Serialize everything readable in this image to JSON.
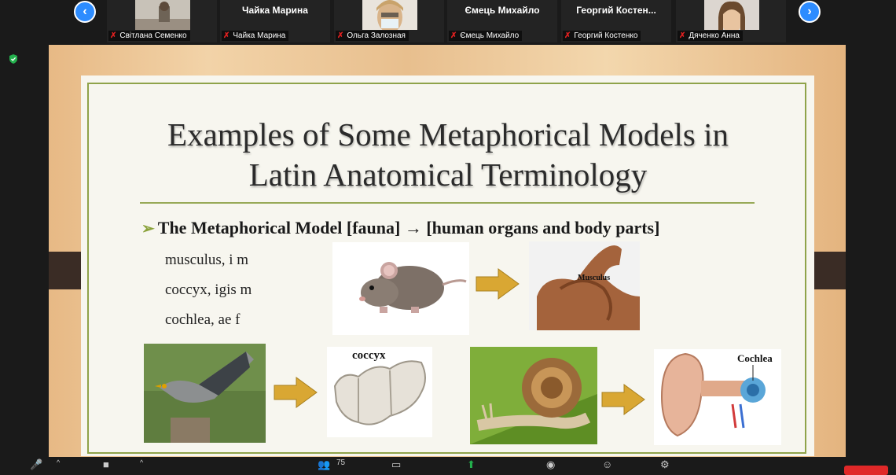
{
  "participants": [
    {
      "name": "Світлана Семенко",
      "display": "",
      "video": true
    },
    {
      "name": "Чайка Марина",
      "display": "Чайка Марина",
      "video": false
    },
    {
      "name": "Ольга Залозная",
      "display": "",
      "video": true
    },
    {
      "name": "Ємець Михайло",
      "display": "Ємець Михайло",
      "video": false
    },
    {
      "name": "Георгий Костенко",
      "display": "Георгий  Костен...",
      "video": false
    },
    {
      "name": "Дяченко Анна",
      "display": "",
      "video": true
    }
  ],
  "slide": {
    "title_line1": "Examples of Some Metaphorical Models in",
    "title_line2": "Latin Anatomical Terminology",
    "bullet": "The Metaphorical Model [fauna] → [human organs and body parts]",
    "terms": [
      "musculus, i m",
      "coccyx, igis m",
      "cochlea, ae f"
    ],
    "captions": {
      "musculus": "Musculus",
      "coccyx": "coccyx",
      "cochlea": "Cochlea"
    }
  },
  "toolbar": {
    "participant_count": "75"
  },
  "colors": {
    "accent_blue": "#2d8cff",
    "muted_red": "#e02020",
    "slide_border": "#8fa34a",
    "arrow_gold": "#d9a733"
  }
}
